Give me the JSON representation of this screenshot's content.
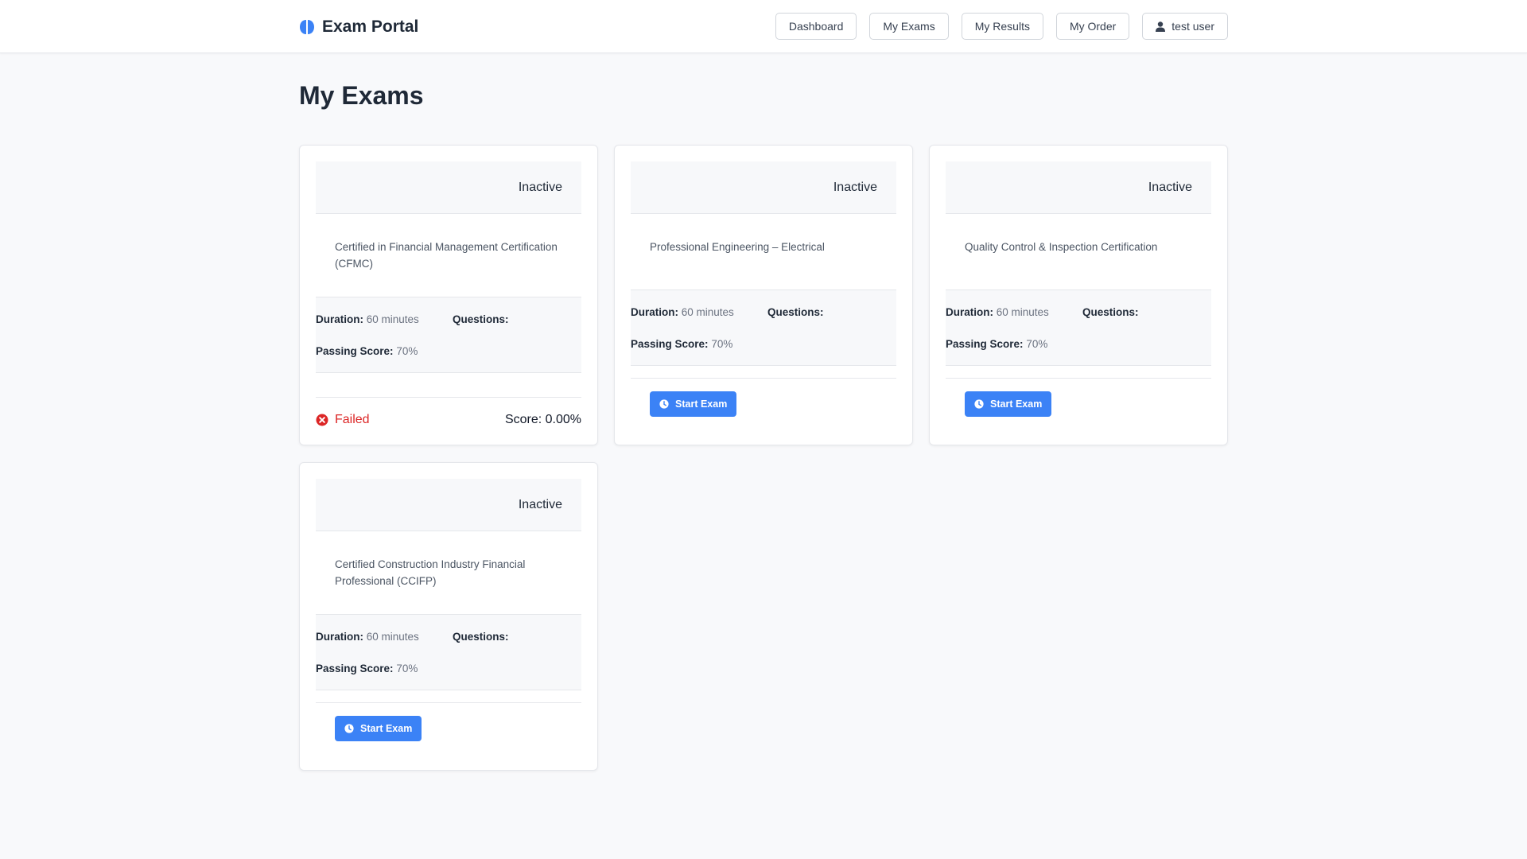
{
  "app": {
    "brand": "Exam Portal"
  },
  "nav": {
    "dashboard": "Dashboard",
    "my_exams": "My Exams",
    "my_results": "My Results",
    "my_order": "My Order",
    "user": "test user"
  },
  "page": {
    "title": "My Exams"
  },
  "labels": {
    "duration": "Duration:",
    "questions": "Questions:",
    "passing_score": "Passing Score:",
    "start_exam": "Start Exam"
  },
  "colors": {
    "primary": "#3b82f6",
    "failed": "#dc2626",
    "background": "#f8f9fb"
  },
  "exams": [
    {
      "status": "Inactive",
      "title": "Certified in Financial Management Certification (CFMC)",
      "duration": "60 minutes",
      "questions": "",
      "passing_score": "70%",
      "result": "Failed",
      "score": "Score: 0.00%"
    },
    {
      "status": "Inactive",
      "title": "Professional Engineering – Electrical",
      "duration": "60 minutes",
      "questions": "",
      "passing_score": "70%"
    },
    {
      "status": "Inactive",
      "title": "Quality Control & Inspection Certification",
      "duration": "60 minutes",
      "questions": "",
      "passing_score": "70%"
    },
    {
      "status": "Inactive",
      "title": "Certified Construction Industry Financial Professional (CCIFP)",
      "duration": "60 minutes",
      "questions": "",
      "passing_score": "70%"
    }
  ]
}
